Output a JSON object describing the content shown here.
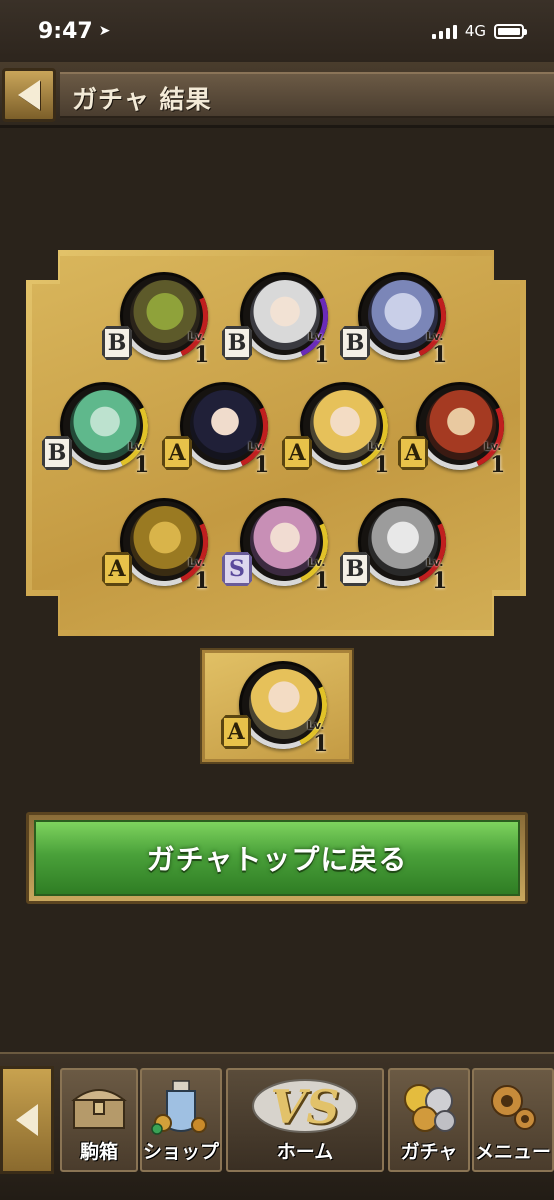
{
  "status_bar": {
    "time": "9:47",
    "network": "4G"
  },
  "header": {
    "title": "ガチャ 結果"
  },
  "results": [
    {
      "rank": "B",
      "lv_label": "Lv.",
      "level": "1",
      "arc": "red"
    },
    {
      "rank": "B",
      "lv_label": "Lv.",
      "level": "1",
      "arc": "purple"
    },
    {
      "rank": "B",
      "lv_label": "Lv.",
      "level": "1",
      "arc": "red"
    },
    {
      "rank": "B",
      "lv_label": "Lv.",
      "level": "1",
      "arc": "yellow"
    },
    {
      "rank": "A",
      "lv_label": "Lv.",
      "level": "1",
      "arc": "red"
    },
    {
      "rank": "A",
      "lv_label": "Lv.",
      "level": "1",
      "arc": "yellow"
    },
    {
      "rank": "A",
      "lv_label": "Lv.",
      "level": "1",
      "arc": "red"
    },
    {
      "rank": "A",
      "lv_label": "Lv.",
      "level": "1",
      "arc": "red"
    },
    {
      "rank": "S",
      "lv_label": "Lv.",
      "level": "1",
      "arc": "yellow"
    },
    {
      "rank": "B",
      "lv_label": "Lv.",
      "level": "1",
      "arc": "red"
    }
  ],
  "highlight": {
    "rank": "A",
    "lv_label": "Lv.",
    "level": "1"
  },
  "main_button": {
    "label": "ガチャトップに戻る"
  },
  "bottom_nav": {
    "items": [
      {
        "label": "駒箱",
        "icon": "chest-icon"
      },
      {
        "label": "ショップ",
        "icon": "potion-icon"
      },
      {
        "label": "ホーム",
        "icon": "vs-icon",
        "logo": "VS"
      },
      {
        "label": "ガチャ",
        "icon": "coins-icon"
      },
      {
        "label": "メニュー",
        "icon": "gear-icon"
      }
    ]
  }
}
